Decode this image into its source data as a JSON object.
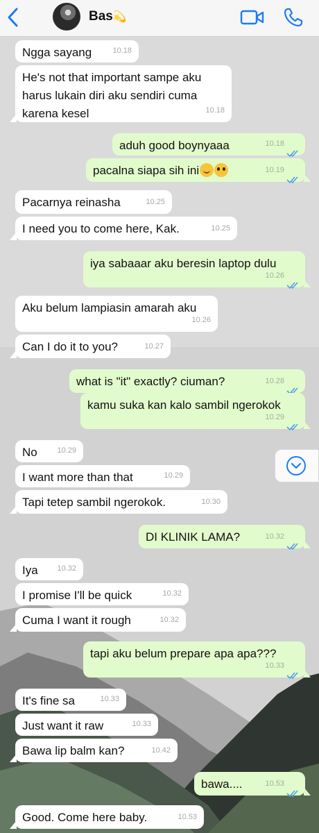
{
  "header": {
    "contact_name": "Bas",
    "contact_emoji": "💫",
    "icons": {
      "back": "chevron-left-icon",
      "video": "video-call-icon",
      "call": "phone-icon",
      "scroll": "scroll-down-icon"
    }
  },
  "colors": {
    "accent": "#1a7cf5",
    "incoming_bubble": "#ffffff",
    "outgoing_bubble": "#e2fbcc",
    "read_ticks": "#4fa0e6"
  },
  "messages": [
    {
      "dir": "in",
      "text": "Ngga sayang",
      "time": "10.18"
    },
    {
      "dir": "in",
      "text": "He's not that important sampe aku harus lukain diri aku sendiri cuma karena kesel",
      "time": "10.18"
    },
    {
      "dir": "out",
      "text": "aduh good boynyaaa",
      "time": "10.18"
    },
    {
      "dir": "out",
      "text": "pacalna siapa sih ini",
      "emojis": [
        "hugging-face",
        "pleading-face"
      ],
      "time": "10.19"
    },
    {
      "dir": "in",
      "text": "Pacarnya reinasha",
      "time": "10.25"
    },
    {
      "dir": "in",
      "text": "I need you to come here, Kak.",
      "time": "10.25"
    },
    {
      "dir": "out",
      "text": "iya sabaaar aku beresin laptop dulu",
      "time": "10.26"
    },
    {
      "dir": "in",
      "text": "Aku belum lampiasin amarah aku",
      "time": "10.26"
    },
    {
      "dir": "in",
      "text": "Can I do it to you?",
      "time": "10.27"
    },
    {
      "dir": "out",
      "text": "what is \"it\" exactly? ciuman?",
      "time": "10.28"
    },
    {
      "dir": "out",
      "text": "kamu suka kan kalo sambil ngerokok",
      "time": "10.29"
    },
    {
      "dir": "in",
      "text": "No",
      "time": "10.29"
    },
    {
      "dir": "in",
      "text": "I want more than that",
      "time": "10.29"
    },
    {
      "dir": "in",
      "text": "Tapi tetep sambil ngerokok.",
      "time": "10.30"
    },
    {
      "dir": "out",
      "text": "DI KLINIK LAMA?",
      "time": "10.32"
    },
    {
      "dir": "in",
      "text": "Iya",
      "time": "10.32"
    },
    {
      "dir": "in",
      "text": "I promise I'll be quick",
      "time": "10.32"
    },
    {
      "dir": "in",
      "text": "Cuma I want it rough",
      "time": "10.32"
    },
    {
      "dir": "out",
      "text": "tapi aku belum prepare apa apa???",
      "time": "10.33"
    },
    {
      "dir": "in",
      "text": "It's fine sa",
      "time": "10.33"
    },
    {
      "dir": "in",
      "text": "Just want it raw",
      "time": "10.33"
    },
    {
      "dir": "in",
      "text": "Bawa lip balm kan?",
      "time": "10.42"
    },
    {
      "dir": "out",
      "text": "bawa....",
      "time": "10.53"
    },
    {
      "dir": "in",
      "text": "Good. Come here baby.",
      "time": "10.53"
    }
  ]
}
